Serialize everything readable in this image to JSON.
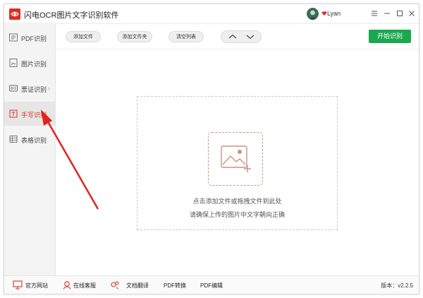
{
  "app": {
    "title": "闪电OCR图片文字识别软件",
    "username": "Lyan"
  },
  "sidebar": {
    "items": [
      {
        "label": "PDF识别",
        "icon": "pdf-icon"
      },
      {
        "label": "图片识别",
        "icon": "image-icon"
      },
      {
        "label": "票证识别",
        "icon": "ticket-icon",
        "has_submenu": true
      },
      {
        "label": "手写识别",
        "icon": "handwriting-icon",
        "active": true
      },
      {
        "label": "表格识别",
        "icon": "table-icon"
      }
    ]
  },
  "toolbar": {
    "add_file": "添加文件",
    "add_folder": "添加文件夹",
    "clear_list": "清空列表",
    "start": "开始识别"
  },
  "main": {
    "drop_line1": "点击添加文件或拖拽文件到此处",
    "drop_line2": "请确保上传的图片中文字朝向正确"
  },
  "footer": {
    "official_site": "官方网站",
    "online_service": "在线客服",
    "doc_translate": "文档翻译",
    "pdf_convert": "PDF转换",
    "pdf_edit": "PDF编辑",
    "version": "版本：v2.2.5"
  },
  "colors": {
    "accent": "#d93025",
    "start_green": "#1aa84f",
    "drop_border": "#c89583"
  }
}
